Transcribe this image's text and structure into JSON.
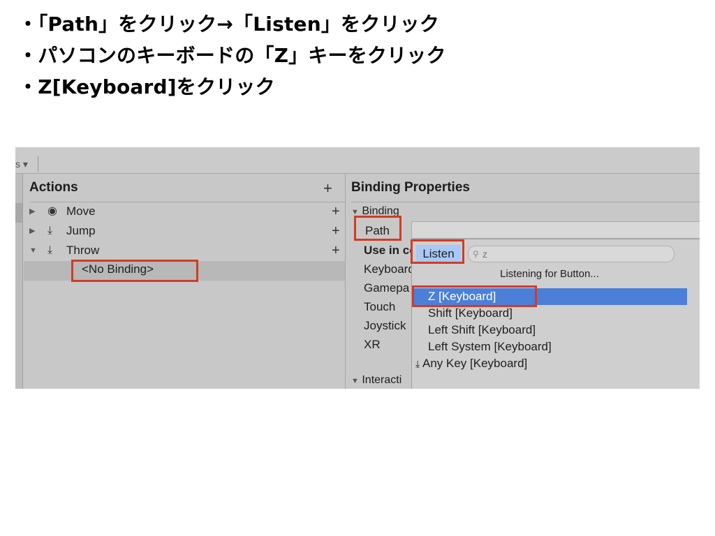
{
  "instructions": [
    "・「Path」をクリック→「Listen」をクリック",
    "・パソコンのキーボードの「Z」キーをクリック",
    "・Z[Keyboard]をクリック"
  ],
  "editor": {
    "tab_stub": "s ▾",
    "actions_panel": {
      "title": "Actions",
      "add_symbol": "+",
      "items": [
        {
          "label": "Move",
          "icon": "radio-icon",
          "expanded": false
        },
        {
          "label": "Jump",
          "icon": "download-icon",
          "expanded": false
        },
        {
          "label": "Throw",
          "icon": "download-icon",
          "expanded": true
        }
      ],
      "binding_child": "<No Binding>"
    },
    "binding_properties": {
      "title": "Binding Properties",
      "section_binding": "Binding",
      "path_label": "Path",
      "use_in": "Use in co",
      "schemes": [
        "Keyboard",
        "Gamepa",
        "Touch",
        "Joystick",
        "XR"
      ],
      "section_interactions": "Interacti"
    },
    "popup": {
      "listen_label": "Listen",
      "search_value": "z",
      "status": "Listening for Button...",
      "options": [
        "Z [Keyboard]",
        "Shift [Keyboard]",
        "Left Shift [Keyboard]",
        "Left System [Keyboard]",
        "Any Key [Keyboard]"
      ],
      "selected_index": 0
    }
  },
  "colors": {
    "highlight_box": "#d13c25",
    "selection": "#4b7fd8",
    "listen_button": "#a9c8f5"
  }
}
